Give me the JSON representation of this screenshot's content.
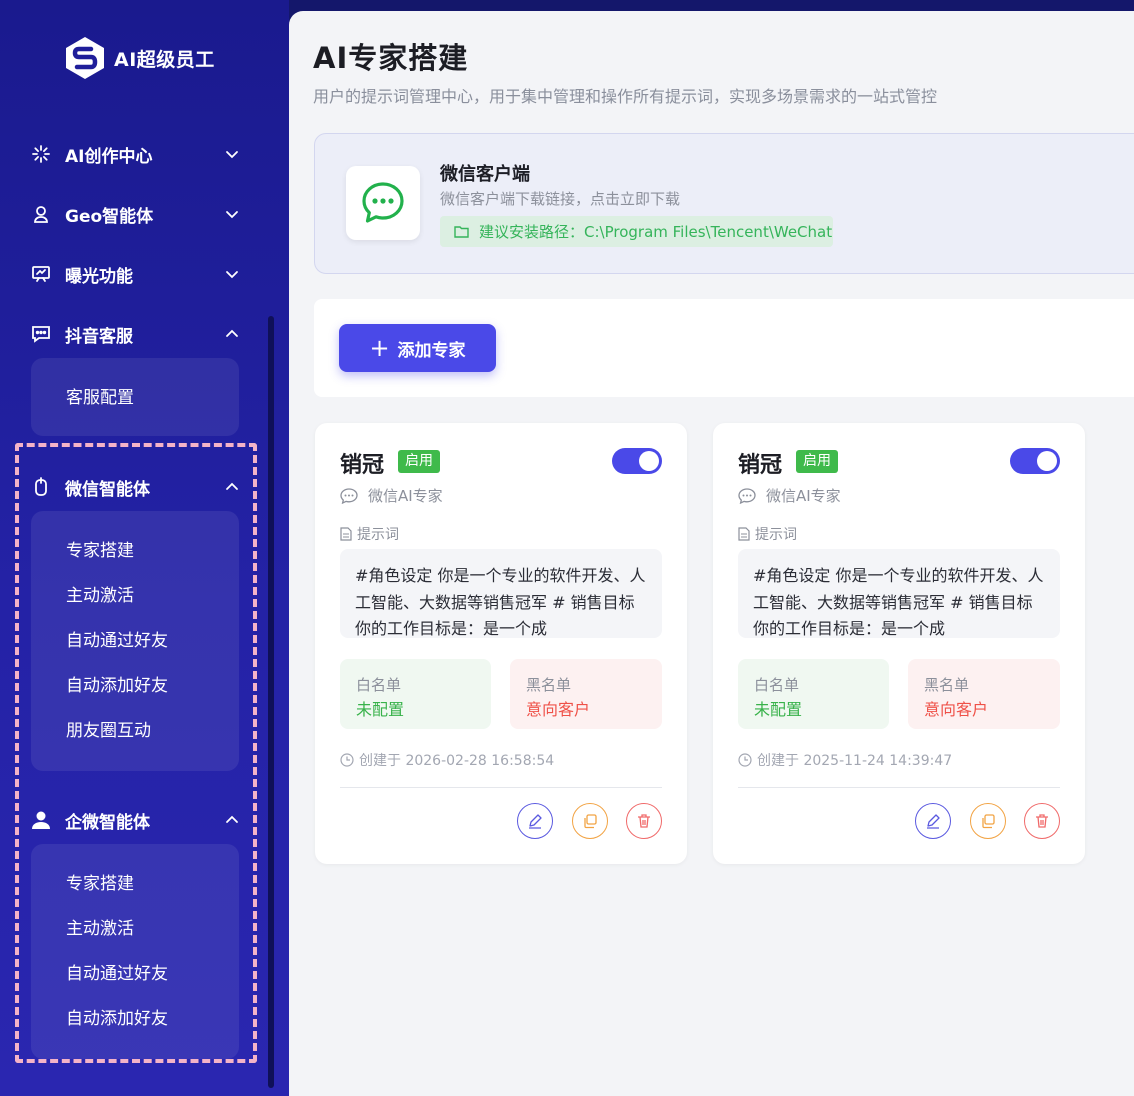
{
  "app": {
    "name": "AI超级员工"
  },
  "sidebar": {
    "groups": [
      {
        "label": "AI创作中心",
        "icon": "sparkle-icon",
        "expanded": false
      },
      {
        "label": "Geo智能体",
        "icon": "location-user-icon",
        "expanded": false
      },
      {
        "label": "曝光功能",
        "icon": "presentation-icon",
        "expanded": false
      },
      {
        "label": "抖音客服",
        "icon": "chat-dots-icon",
        "expanded": true,
        "items": [
          "客服配置"
        ]
      },
      {
        "label": "微信智能体",
        "icon": "mouse-icon",
        "expanded": true,
        "items": [
          "专家搭建",
          "主动激活",
          "自动通过好友",
          "自动添加好友",
          "朋友圈互动"
        ]
      },
      {
        "label": "企微智能体",
        "icon": "user-icon",
        "expanded": true,
        "items": [
          "专家搭建",
          "主动激活",
          "自动通过好友",
          "自动添加好友"
        ]
      }
    ]
  },
  "page": {
    "title": "AI专家搭建",
    "subtitle": "用户的提示词管理中心，用于集中管理和操作所有提示词，实现多场景需求的一站式管控"
  },
  "wechat_client": {
    "title": "微信客户端",
    "desc": "微信客户端下载链接，点击立即下载",
    "path": "建议安装路径：C:\\Program Files\\Tencent\\WeChat"
  },
  "toolbar": {
    "add_label": "添加专家",
    "add_icon": "+"
  },
  "experts": [
    {
      "name": "销冠",
      "status": "启用",
      "enabled": true,
      "type": "微信AI专家",
      "prompt_label": "提示词",
      "prompt": "#角色设定 你是一个专业的软件开发、人工智能、大数据等销售冠军 # 销售目标 你的工作目标是：是一个成",
      "whitelist_label": "白名单",
      "whitelist_value": "未配置",
      "blacklist_label": "黑名单",
      "blacklist_value": "意向客户",
      "created": "创建于 2026-02-28 16:58:54"
    },
    {
      "name": "销冠",
      "status": "启用",
      "enabled": true,
      "type": "微信AI专家",
      "prompt_label": "提示词",
      "prompt": "#角色设定 你是一个专业的软件开发、人工智能、大数据等销售冠军 # 销售目标 你的工作目标是：是一个成",
      "whitelist_label": "白名单",
      "whitelist_value": "未配置",
      "blacklist_label": "黑名单",
      "blacklist_value": "意向客户",
      "created": "创建于 2025-11-24 14:39:47"
    }
  ],
  "colors": {
    "sidebar_bg": "#1f1e9a",
    "accent": "#4a49e8",
    "success": "#3fba4b",
    "danger": "#ef5148",
    "highlight_dash": "#f4b3c8"
  }
}
